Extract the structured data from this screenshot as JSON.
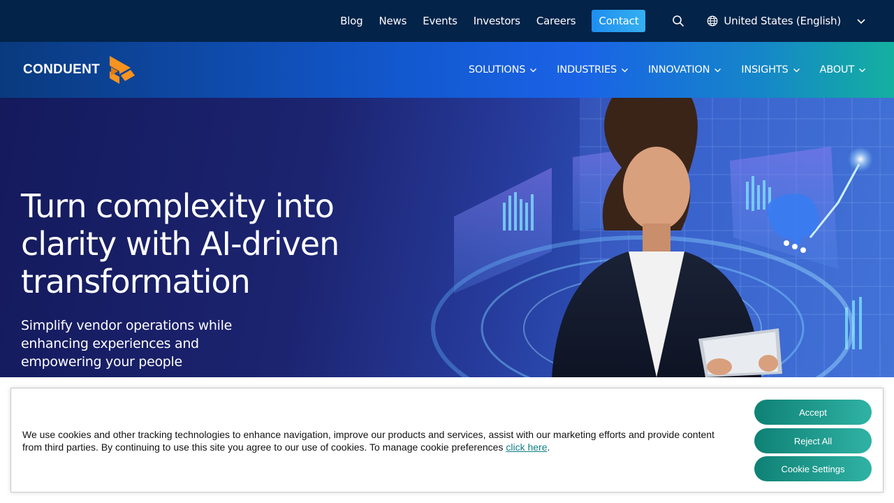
{
  "utility_bar": {
    "links": [
      "Blog",
      "News",
      "Events",
      "Investors",
      "Careers"
    ],
    "contact_label": "Contact",
    "region_label": "United States (English)",
    "icons": {
      "search": "search-icon",
      "globe": "globe-icon",
      "region_dropdown": "chevron-down-icon"
    }
  },
  "main_nav": {
    "logo_text": "CONDUENT",
    "items": [
      "SOLUTIONS",
      "INDUSTRIES",
      "INNOVATION",
      "INSIGHTS",
      "ABOUT"
    ]
  },
  "hero": {
    "title": "Turn complexity into clarity with AI-driven transformation",
    "subtitle": "Simplify vendor operations while enhancing experiences and empowering your people"
  },
  "cookie_banner": {
    "text": "We use cookies and other tracking technologies to enhance navigation, improve our products and services, assist with our marketing efforts and provide content from third parties. By continuing to use this site you agree to our use of cookies. To manage cookie preferences ",
    "link_text": "click here",
    "trailing": ".",
    "accept_label": "Accept",
    "reject_label": "Reject All",
    "settings_label": "Cookie Settings"
  },
  "colors": {
    "utility_bg": "#032349",
    "contact_btn": "#1e8ef0",
    "logo_orange": "#f7931e",
    "cookie_btn": "#1a9a8c",
    "cookie_link": "#0f7e86"
  }
}
